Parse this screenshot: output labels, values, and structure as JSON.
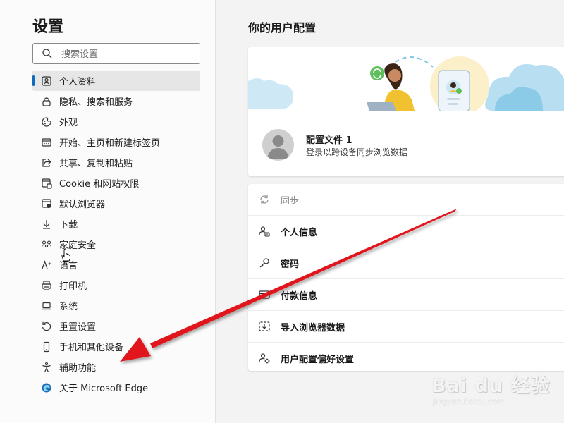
{
  "sidebar": {
    "title": "设置",
    "search_placeholder": "搜索设置",
    "items": [
      {
        "label": "个人资料",
        "icon": "profile-icon",
        "active": true
      },
      {
        "label": "隐私、搜索和服务",
        "icon": "lock-icon"
      },
      {
        "label": "外观",
        "icon": "appearance-icon"
      },
      {
        "label": "开始、主页和新建标签页",
        "icon": "home-tab-icon"
      },
      {
        "label": "共享、复制和粘贴",
        "icon": "share-icon"
      },
      {
        "label": "Cookie 和网站权限",
        "icon": "site-permissions-icon"
      },
      {
        "label": "默认浏览器",
        "icon": "default-browser-icon"
      },
      {
        "label": "下载",
        "icon": "download-icon"
      },
      {
        "label": "家庭安全",
        "icon": "family-icon"
      },
      {
        "label": "语言",
        "icon": "language-icon"
      },
      {
        "label": "打印机",
        "icon": "printer-icon"
      },
      {
        "label": "系统",
        "icon": "laptop-icon"
      },
      {
        "label": "重置设置",
        "icon": "reset-icon"
      },
      {
        "label": "手机和其他设备",
        "icon": "phone-icon"
      },
      {
        "label": "辅助功能",
        "icon": "accessibility-icon"
      },
      {
        "label": "关于 Microsoft Edge",
        "icon": "edge-logo-icon"
      }
    ]
  },
  "main": {
    "title": "你的用户配置",
    "profile": {
      "name": "配置文件 1",
      "description": "登录以跨设备同步浏览数据"
    },
    "options": [
      {
        "label": "同步",
        "icon": "sync-icon",
        "muted": true
      },
      {
        "label": "个人信息",
        "icon": "personal-info-icon"
      },
      {
        "label": "密码",
        "icon": "key-icon"
      },
      {
        "label": "付款信息",
        "icon": "card-icon"
      },
      {
        "label": "导入浏览器数据",
        "icon": "import-icon"
      },
      {
        "label": "用户配置偏好设置",
        "icon": "profile-preferences-icon"
      }
    ]
  },
  "watermark": {
    "logo": "Bai du 经验",
    "url": "jingyan.baidu.com"
  },
  "colors": {
    "accent": "#0f6cbd",
    "annotation_arrow": "#e0141e"
  }
}
